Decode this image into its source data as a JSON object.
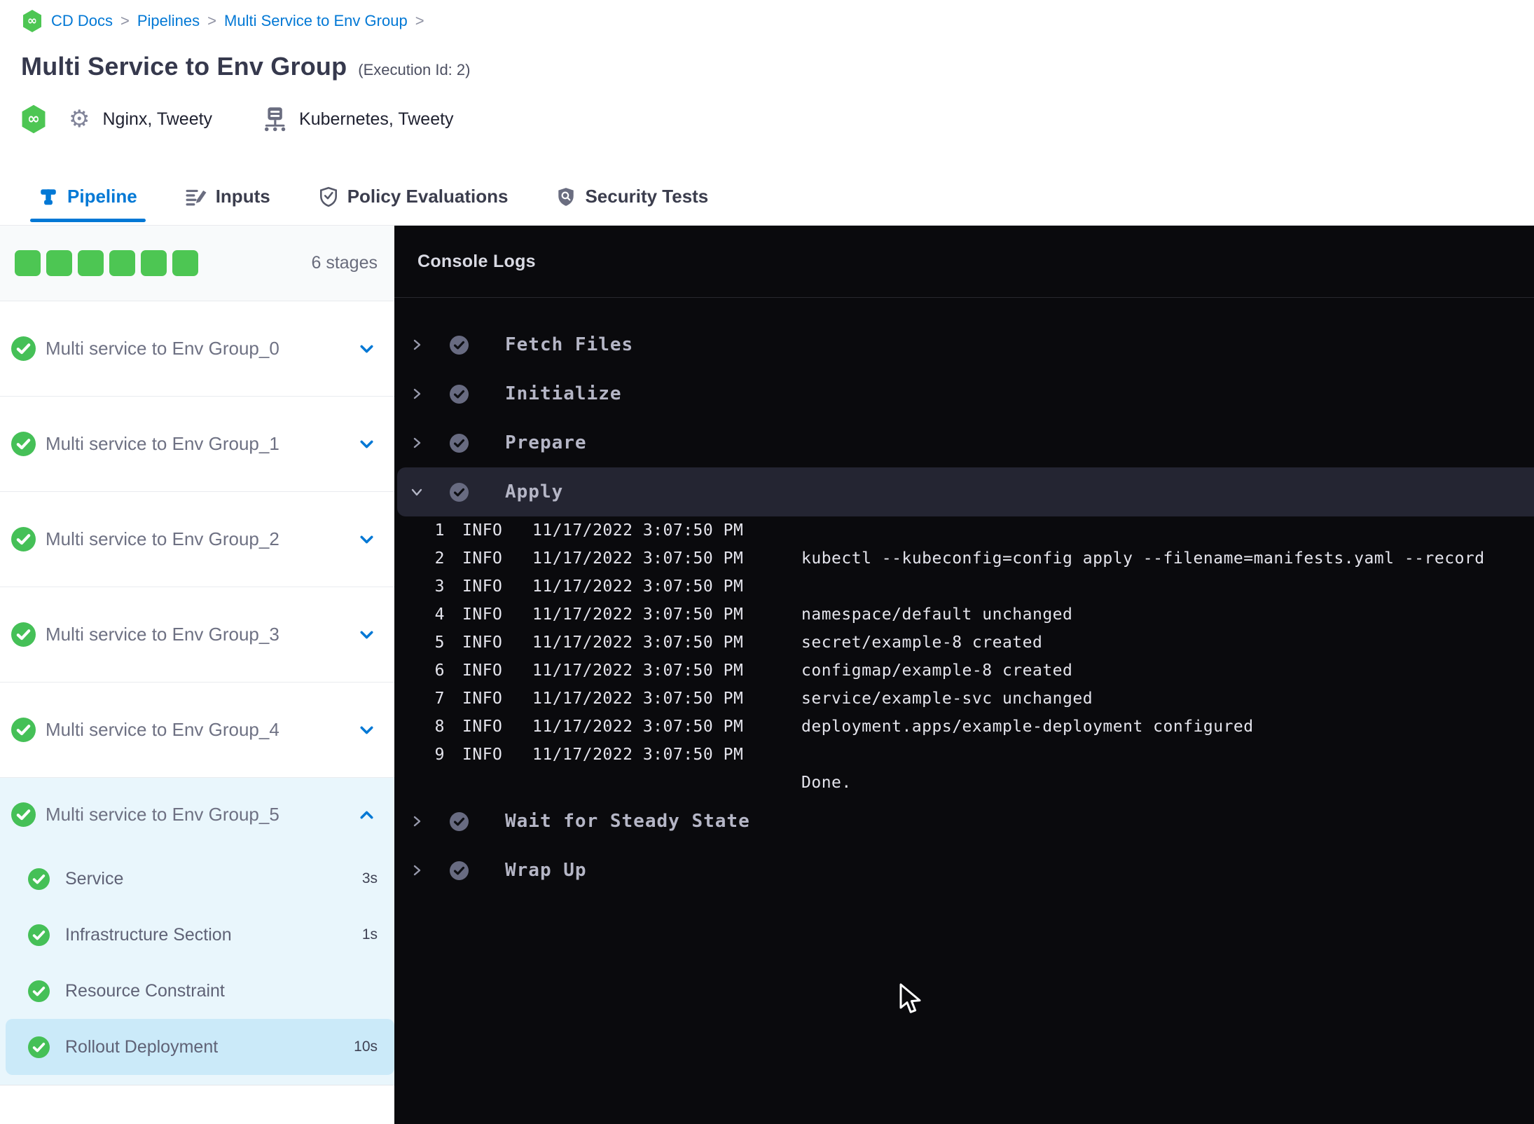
{
  "breadcrumb": {
    "separator": ">",
    "items": [
      "CD Docs",
      "Pipelines",
      "Multi Service to Env Group"
    ]
  },
  "header": {
    "title": "Multi Service to Env Group",
    "execution_id": "(Execution Id: 2)",
    "services": "Nginx, Tweety",
    "environments": "Kubernetes, Tweety"
  },
  "tabs": [
    {
      "label": "Pipeline",
      "active": true
    },
    {
      "label": "Inputs",
      "active": false
    },
    {
      "label": "Policy Evaluations",
      "active": false
    },
    {
      "label": "Security Tests",
      "active": false
    }
  ],
  "sidebar": {
    "stage_count_label": "6 stages",
    "completed_squares": 6,
    "stages": [
      {
        "label": "Multi service to Env Group_0",
        "status": "success",
        "expanded": false
      },
      {
        "label": "Multi service to Env Group_1",
        "status": "success",
        "expanded": false
      },
      {
        "label": "Multi service to Env Group_2",
        "status": "success",
        "expanded": false
      },
      {
        "label": "Multi service to Env Group_3",
        "status": "success",
        "expanded": false
      },
      {
        "label": "Multi service to Env Group_4",
        "status": "success",
        "expanded": false
      },
      {
        "label": "Multi service to Env Group_5",
        "status": "success",
        "expanded": true,
        "steps": [
          {
            "label": "Service",
            "duration": "3s",
            "selected": false
          },
          {
            "label": "Infrastructure Section",
            "duration": "1s",
            "selected": false
          },
          {
            "label": "Resource Constraint",
            "duration": "",
            "selected": false
          },
          {
            "label": "Rollout Deployment",
            "duration": "10s",
            "selected": true
          }
        ]
      }
    ]
  },
  "console": {
    "title": "Console Logs",
    "steps": [
      {
        "label": "Fetch Files",
        "status": "success",
        "expanded": false
      },
      {
        "label": "Initialize",
        "status": "success",
        "expanded": false
      },
      {
        "label": "Prepare",
        "status": "success",
        "expanded": false
      },
      {
        "label": "Apply",
        "status": "success",
        "expanded": true
      },
      {
        "label": "Wait for Steady State",
        "status": "success",
        "expanded": false
      },
      {
        "label": "Wrap Up",
        "status": "success",
        "expanded": false
      }
    ],
    "apply_logs": [
      {
        "n": "1",
        "level": "INFO",
        "time": "11/17/2022 3:07:50 PM",
        "msg": ""
      },
      {
        "n": "2",
        "level": "INFO",
        "time": "11/17/2022 3:07:50 PM",
        "msg": "kubectl --kubeconfig=config apply --filename=manifests.yaml --record"
      },
      {
        "n": "3",
        "level": "INFO",
        "time": "11/17/2022 3:07:50 PM",
        "msg": ""
      },
      {
        "n": "4",
        "level": "INFO",
        "time": "11/17/2022 3:07:50 PM",
        "msg": "namespace/default unchanged"
      },
      {
        "n": "5",
        "level": "INFO",
        "time": "11/17/2022 3:07:50 PM",
        "msg": "secret/example-8 created"
      },
      {
        "n": "6",
        "level": "INFO",
        "time": "11/17/2022 3:07:50 PM",
        "msg": "configmap/example-8 created"
      },
      {
        "n": "7",
        "level": "INFO",
        "time": "11/17/2022 3:07:50 PM",
        "msg": "service/example-svc unchanged"
      },
      {
        "n": "8",
        "level": "INFO",
        "time": "11/17/2022 3:07:50 PM",
        "msg": "deployment.apps/example-deployment configured"
      },
      {
        "n": "9",
        "level": "INFO",
        "time": "11/17/2022 3:07:50 PM",
        "msg": ""
      },
      {
        "n": "",
        "level": "",
        "time": "",
        "msg": "Done."
      }
    ]
  },
  "icons": {
    "logo": "harness-infinity-hexagon",
    "services": "gear-icon",
    "environments": "server-icon",
    "stage_status": "check-circle-icon",
    "expand": "chevron-icon"
  },
  "colors": {
    "accent_blue": "#0278d5",
    "success_green": "#4dc653",
    "console_bg": "#0a0a0d",
    "apply_row_bg": "#242532",
    "stage_group_bg": "#e9f6fc",
    "selected_step_bg": "#cbeaf9"
  }
}
